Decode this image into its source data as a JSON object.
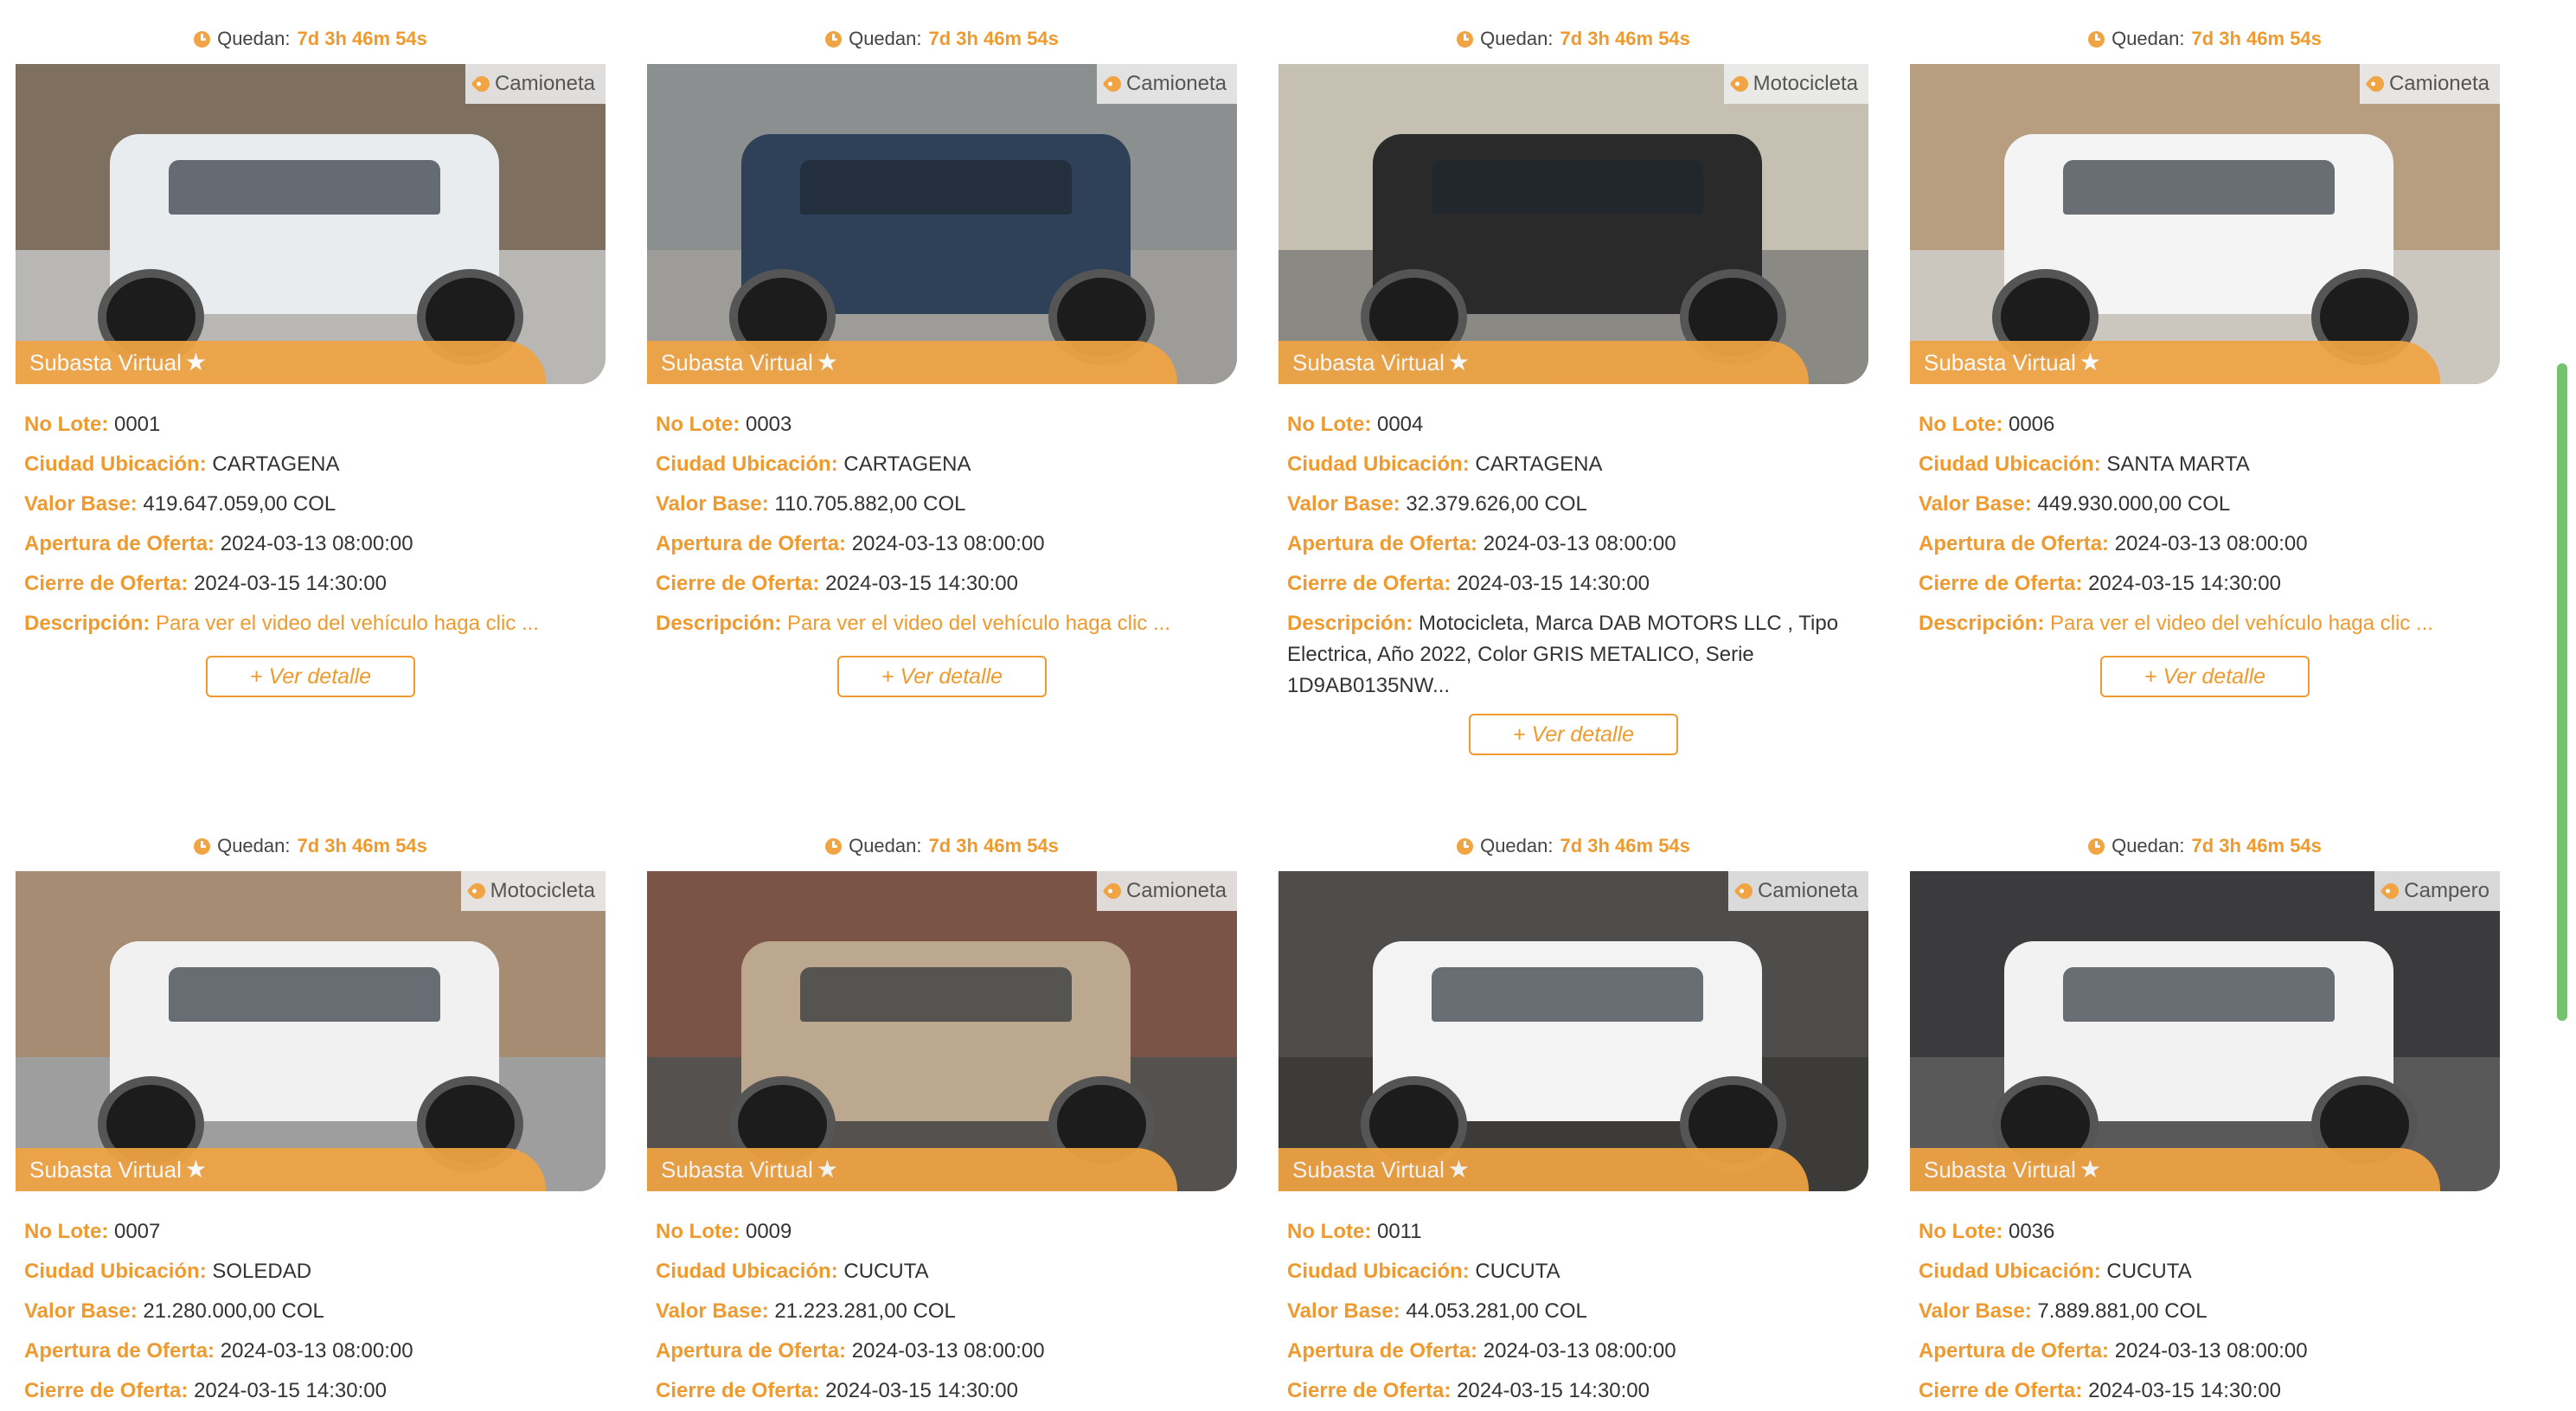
{
  "timer": {
    "prefix": "Quedan:",
    "value": "7d 3h 46m 54s"
  },
  "labels": {
    "lot": "No Lote:",
    "city": "Ciudad Ubicación:",
    "base": "Valor Base:",
    "open": "Apertura de Oferta:",
    "close": "Cierre de Oferta:",
    "description": "Descripción:"
  },
  "banner": {
    "text": "Subasta Virtual"
  },
  "button": {
    "label": "+ Ver detalle"
  },
  "cards": [
    {
      "category": "Camioneta",
      "lot": "0001",
      "city": "CARTAGENA",
      "base_value": "419.647.059,00 COL",
      "open": "2024-03-13 08:00:00",
      "close": "2024-03-15 14:30:00",
      "description": "Para ver el video del vehículo haga clic ...",
      "vehicle_color": "#e9ecef",
      "wall_color": "#7e6f5f",
      "floor_color": "#b8b7b4"
    },
    {
      "category": "Camioneta",
      "lot": "0003",
      "city": "CARTAGENA",
      "base_value": "110.705.882,00 COL",
      "open": "2024-03-13 08:00:00",
      "close": "2024-03-15 14:30:00",
      "description": "Para ver el video del vehículo haga clic ...",
      "vehicle_color": "#2e4158",
      "wall_color": "#8c8f8f",
      "floor_color": "#9d9c99"
    },
    {
      "category": "Motocicleta",
      "lot": "0004",
      "city": "CARTAGENA",
      "base_value": "32.379.626,00 COL",
      "open": "2024-03-13 08:00:00",
      "close": "2024-03-15 14:30:00",
      "description": "Motocicleta, Marca DAB MOTORS LLC , Tipo Electrica, Año 2022, Color GRIS METALICO, Serie 1D9AB0135NW...",
      "vehicle_color": "#2a2a2a",
      "wall_color": "#c6c0b3",
      "floor_color": "#8b8984"
    },
    {
      "category": "Camioneta",
      "lot": "0006",
      "city": "SANTA MARTA",
      "base_value": "449.930.000,00 COL",
      "open": "2024-03-13 08:00:00",
      "close": "2024-03-15 14:30:00",
      "description": "Para ver el video del vehículo haga clic ...",
      "vehicle_color": "#f4f4f4",
      "wall_color": "#b89e80",
      "floor_color": "#cbc6be"
    },
    {
      "category": "Motocicleta",
      "lot": "0007",
      "city": "SOLEDAD",
      "base_value": "21.280.000,00 COL",
      "open": "2024-03-13 08:00:00",
      "close": "2024-03-15 14:30:00",
      "vehicle_color": "#f1f1f1",
      "wall_color": "#a68c72",
      "floor_color": "#9e9e9e"
    },
    {
      "category": "Camioneta",
      "lot": "0009",
      "city": "CUCUTA",
      "base_value": "21.223.281,00 COL",
      "open": "2024-03-13 08:00:00",
      "close": "2024-03-15 14:30:00",
      "vehicle_color": "#bba88e",
      "wall_color": "#7a5446",
      "floor_color": "#55514f"
    },
    {
      "category": "Camioneta",
      "lot": "0011",
      "city": "CUCUTA",
      "base_value": "44.053.281,00 COL",
      "open": "2024-03-13 08:00:00",
      "close": "2024-03-15 14:30:00",
      "vehicle_color": "#f3f3f3",
      "wall_color": "#4f4d4b",
      "floor_color": "#3c3b3a"
    },
    {
      "category": "Campero",
      "lot": "0036",
      "city": "CUCUTA",
      "base_value": "7.889.881,00 COL",
      "open": "2024-03-13 08:00:00",
      "close": "2024-03-15 14:30:00",
      "vehicle_color": "#f2f2f2",
      "wall_color": "#3b3b3d",
      "floor_color": "#5a5959"
    }
  ]
}
